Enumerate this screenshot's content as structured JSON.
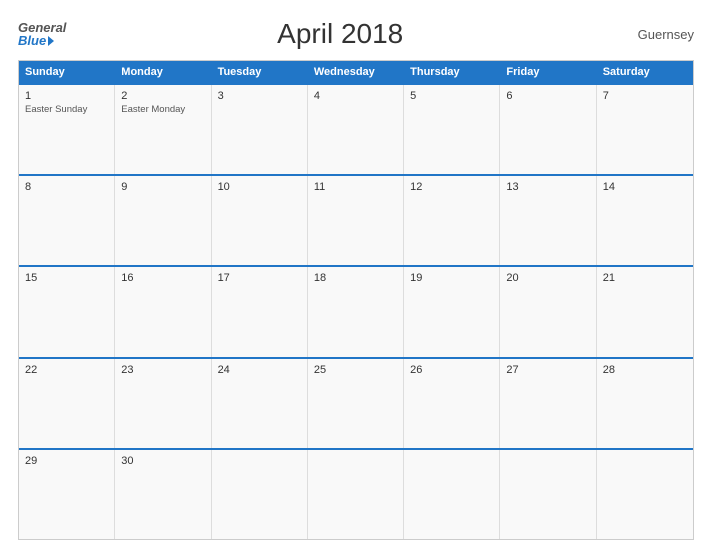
{
  "header": {
    "logo_general": "General",
    "logo_blue": "Blue",
    "title": "April 2018",
    "region": "Guernsey"
  },
  "calendar": {
    "days_of_week": [
      "Sunday",
      "Monday",
      "Tuesday",
      "Wednesday",
      "Thursday",
      "Friday",
      "Saturday"
    ],
    "weeks": [
      [
        {
          "day": "1",
          "events": [
            "Easter Sunday"
          ],
          "empty": false
        },
        {
          "day": "2",
          "events": [
            "Easter Monday"
          ],
          "empty": false
        },
        {
          "day": "3",
          "events": [],
          "empty": false
        },
        {
          "day": "4",
          "events": [],
          "empty": false
        },
        {
          "day": "5",
          "events": [],
          "empty": false
        },
        {
          "day": "6",
          "events": [],
          "empty": false
        },
        {
          "day": "7",
          "events": [],
          "empty": false
        }
      ],
      [
        {
          "day": "8",
          "events": [],
          "empty": false
        },
        {
          "day": "9",
          "events": [],
          "empty": false
        },
        {
          "day": "10",
          "events": [],
          "empty": false
        },
        {
          "day": "11",
          "events": [],
          "empty": false
        },
        {
          "day": "12",
          "events": [],
          "empty": false
        },
        {
          "day": "13",
          "events": [],
          "empty": false
        },
        {
          "day": "14",
          "events": [],
          "empty": false
        }
      ],
      [
        {
          "day": "15",
          "events": [],
          "empty": false
        },
        {
          "day": "16",
          "events": [],
          "empty": false
        },
        {
          "day": "17",
          "events": [],
          "empty": false
        },
        {
          "day": "18",
          "events": [],
          "empty": false
        },
        {
          "day": "19",
          "events": [],
          "empty": false
        },
        {
          "day": "20",
          "events": [],
          "empty": false
        },
        {
          "day": "21",
          "events": [],
          "empty": false
        }
      ],
      [
        {
          "day": "22",
          "events": [],
          "empty": false
        },
        {
          "day": "23",
          "events": [],
          "empty": false
        },
        {
          "day": "24",
          "events": [],
          "empty": false
        },
        {
          "day": "25",
          "events": [],
          "empty": false
        },
        {
          "day": "26",
          "events": [],
          "empty": false
        },
        {
          "day": "27",
          "events": [],
          "empty": false
        },
        {
          "day": "28",
          "events": [],
          "empty": false
        }
      ],
      [
        {
          "day": "29",
          "events": [],
          "empty": false
        },
        {
          "day": "30",
          "events": [],
          "empty": false
        },
        {
          "day": "",
          "events": [],
          "empty": true
        },
        {
          "day": "",
          "events": [],
          "empty": true
        },
        {
          "day": "",
          "events": [],
          "empty": true
        },
        {
          "day": "",
          "events": [],
          "empty": true
        },
        {
          "day": "",
          "events": [],
          "empty": true
        }
      ]
    ]
  }
}
